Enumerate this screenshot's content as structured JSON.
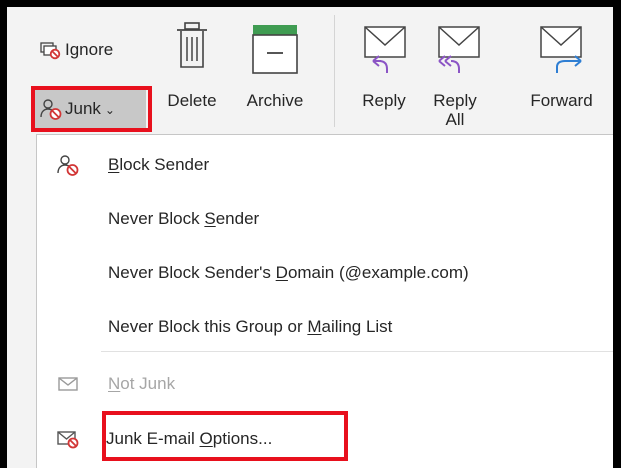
{
  "ribbon": {
    "ignore_label": "Ignore",
    "junk_label": "Junk",
    "junk_chevron": "⌄",
    "delete_label": "Delete",
    "archive_label": "Archive",
    "reply_label": "Reply",
    "reply_all_label": "Reply\nAll",
    "forward_label": "Forward"
  },
  "menu": {
    "items": [
      {
        "pre": "",
        "u": "B",
        "post": "lock Sender",
        "icon": "block-sender-icon"
      },
      {
        "pre": "Never Block ",
        "u": "S",
        "post": "ender",
        "icon": ""
      },
      {
        "pre": "Never Block Sender's ",
        "u": "D",
        "post": "omain (@example.com)",
        "icon": ""
      },
      {
        "pre": "Never Block this Group or ",
        "u": "M",
        "post": "ailing List",
        "icon": ""
      },
      {
        "pre": "",
        "u": "N",
        "post": "ot Junk",
        "icon": "envelope-icon"
      },
      {
        "pre": "Junk E-mail ",
        "u": "O",
        "post": "ptions...",
        "icon": "junk-email-options-icon"
      }
    ]
  },
  "colors": {
    "highlight_outline": "#e8101d",
    "pressed_button": "#c8c8c8",
    "reply_arrow": "#8b54c5",
    "forward_arrow": "#2e7ed3",
    "archive_green": "#3f9c52",
    "block_red": "#d23636"
  }
}
